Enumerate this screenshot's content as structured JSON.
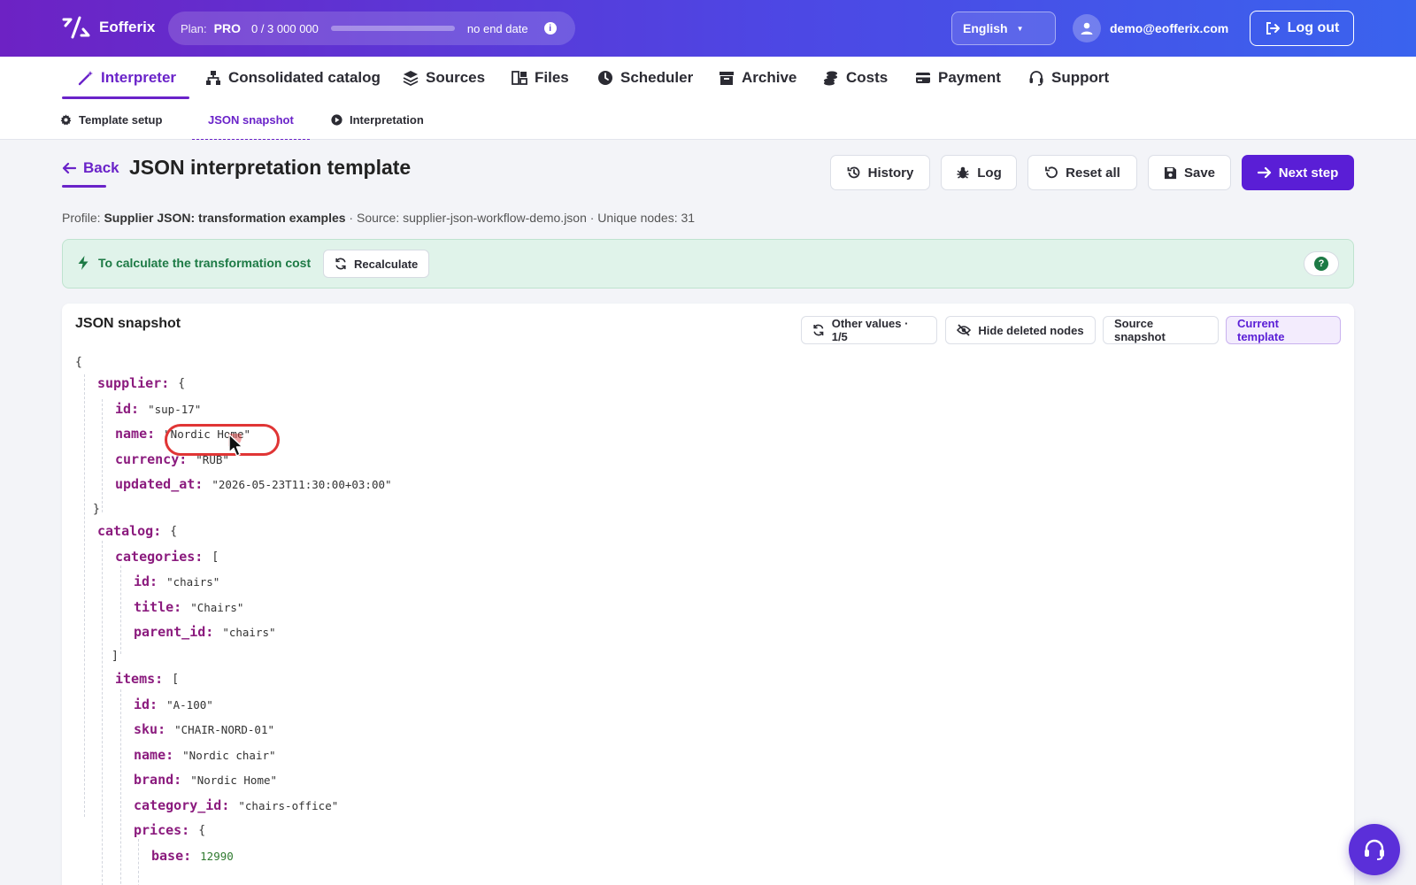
{
  "header": {
    "app_name": "Eofferix",
    "plan_label": "Plan:",
    "plan_tier": "PRO",
    "usage_text": "0  /  3 000 000",
    "usage_fraction": 0,
    "expiry": "no end date",
    "lang_code": "EN",
    "lang_name": "English",
    "user_email": "demo@eofferix.com",
    "logout_label": "Log out"
  },
  "main_nav": [
    {
      "label": "Interpreter",
      "icon": "magic-wand-icon",
      "active": true
    },
    {
      "label": "Consolidated catalog",
      "icon": "sitemap-icon"
    },
    {
      "label": "Sources",
      "icon": "layers-icon"
    },
    {
      "label": "Files",
      "icon": "files-icon"
    },
    {
      "label": "Scheduler",
      "icon": "clock-icon"
    },
    {
      "label": "Archive",
      "icon": "archive-icon"
    },
    {
      "label": "Costs",
      "icon": "coins-icon"
    },
    {
      "label": "Payment",
      "icon": "credit-card-icon"
    },
    {
      "label": "Support",
      "icon": "headset-icon"
    }
  ],
  "sub_nav": [
    {
      "label": "Template setup",
      "icon": "gear-icon"
    },
    {
      "label": "JSON snapshot",
      "active": true
    },
    {
      "label": "Interpretation",
      "icon": "play-circle-icon"
    }
  ],
  "page": {
    "back_label": "Back",
    "title": "JSON interpretation template",
    "buttons": {
      "history": "History",
      "log": "Log",
      "reset": "Reset all",
      "save": "Save",
      "next": "Next step"
    },
    "meta_profile_label": "Profile: ",
    "meta_profile": "Supplier JSON: transformation examples",
    "meta_rest": " · Source: supplier-json-workflow-demo.json · Unique nodes: 31"
  },
  "banner": {
    "text": "To calculate the transformation cost",
    "recalc_label": "Recalculate",
    "help": "?",
    "accent": "#1d7a45"
  },
  "snapshot": {
    "title": "JSON snapshot",
    "other_values": "Other values · 1/5",
    "hide_deleted": "Hide deleted nodes",
    "source_snapshot": "Source snapshot",
    "current_template": "Current template",
    "lines": [
      {
        "t": "{"
      },
      {
        "k": "supplier:",
        "b": "{"
      },
      {
        "k": "id:",
        "s": "\"sup-17\""
      },
      {
        "k": "name:",
        "s": "\"Nordic Home\""
      },
      {
        "k": "currency:",
        "s": "\"RUB\""
      },
      {
        "k": "updated_at:",
        "s": "\"2026-05-23T11:30:00+03:00\""
      },
      {
        "t": "}"
      },
      {
        "k": "catalog:",
        "b": "{"
      },
      {
        "k": "categories:",
        "b": "["
      },
      {
        "k": "id:",
        "s": "\"chairs\""
      },
      {
        "k": "title:",
        "s": "\"Chairs\""
      },
      {
        "k": "parent_id:",
        "s": "\"chairs\""
      },
      {
        "t": "]"
      },
      {
        "k": "items:",
        "b": "["
      },
      {
        "k": "id:",
        "s": "\"A-100\""
      },
      {
        "k": "sku:",
        "s": "\"CHAIR-NORD-01\""
      },
      {
        "k": "name:",
        "s": "\"Nordic chair\""
      },
      {
        "k": "brand:",
        "s": "\"Nordic Home\""
      },
      {
        "k": "category_id:",
        "s": "\"chairs-office\""
      },
      {
        "k": "prices:",
        "b": "{"
      },
      {
        "k": "base:",
        "n": "12990"
      }
    ]
  },
  "colors": {
    "brand_purple": "#6a23c9",
    "primary_button": "#5a1ed6",
    "json_key": "#8b1b7e",
    "json_number": "#2f7a2f",
    "highlight": "#e03535"
  }
}
